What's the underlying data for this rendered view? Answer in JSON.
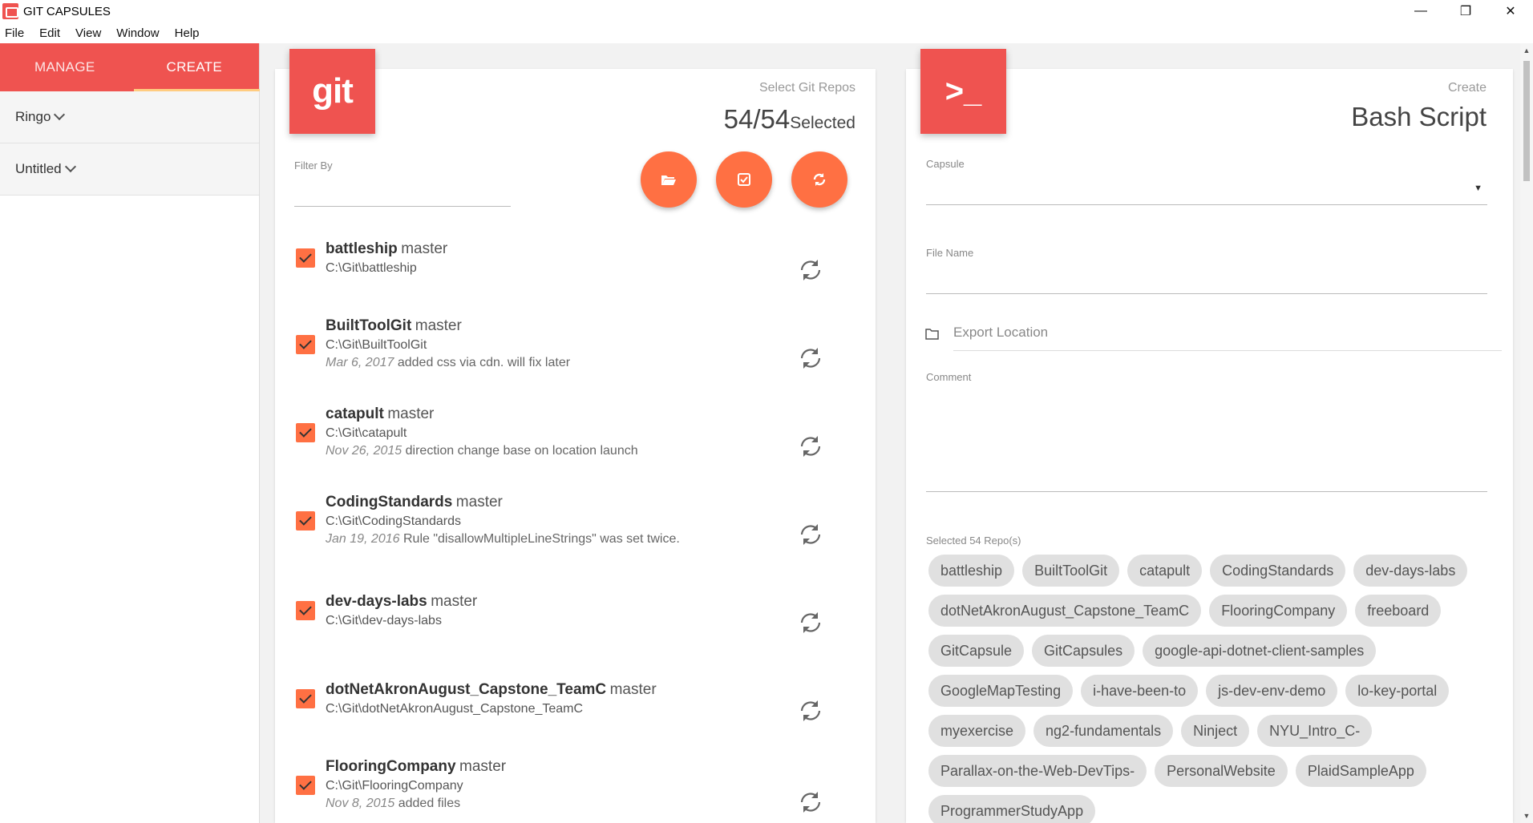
{
  "window": {
    "title": "GIT CAPSULES",
    "controls": [
      "minimize",
      "restore",
      "close"
    ]
  },
  "menu": [
    "File",
    "Edit",
    "View",
    "Window",
    "Help"
  ],
  "sidebar": {
    "tabs": {
      "manage": "MANAGE",
      "create": "CREATE",
      "active": "CREATE"
    },
    "items": [
      {
        "label": "Ringo"
      },
      {
        "label": "Untitled"
      }
    ]
  },
  "repos_panel": {
    "badge": "git",
    "header_small": "Select Git Repos",
    "count": "54/54",
    "count_label": "Selected",
    "filter_label": "Filter By",
    "filter_value": "",
    "actions": [
      {
        "icon": "folder-open-icon"
      },
      {
        "icon": "check-square-icon"
      },
      {
        "icon": "refresh-icon"
      }
    ],
    "repos": [
      {
        "name": "battleship",
        "branch": "master",
        "path": "C:\\Git\\battleship",
        "date": "",
        "message": "",
        "checked": true
      },
      {
        "name": "BuiltToolGit",
        "branch": "master",
        "path": "C:\\Git\\BuiltToolGit",
        "date": "Mar 6, 2017",
        "message": "added css via cdn. will fix later",
        "checked": true
      },
      {
        "name": "catapult",
        "branch": "master",
        "path": "C:\\Git\\catapult",
        "date": "Nov 26, 2015",
        "message": "direction change base on location launch",
        "checked": true
      },
      {
        "name": "CodingStandards",
        "branch": "master",
        "path": "C:\\Git\\CodingStandards",
        "date": "Jan 19, 2016",
        "message": "Rule \"disallowMultipleLineStrings\" was set twice.",
        "checked": true
      },
      {
        "name": "dev-days-labs",
        "branch": "master",
        "path": "C:\\Git\\dev-days-labs",
        "date": "",
        "message": "",
        "checked": true
      },
      {
        "name": "dotNetAkronAugust_Capstone_TeamC",
        "branch": "master",
        "path": "C:\\Git\\dotNetAkronAugust_Capstone_TeamC",
        "date": "",
        "message": "",
        "checked": true
      },
      {
        "name": "FlooringCompany",
        "branch": "master",
        "path": "C:\\Git\\FlooringCompany",
        "date": "Nov 8, 2015",
        "message": "added files",
        "checked": true
      }
    ]
  },
  "script_panel": {
    "badge": ">_",
    "header_small": "Create",
    "header_big": "Bash Script",
    "capsule_label": "Capsule",
    "capsule_value": "",
    "filename_label": "File Name",
    "filename_value": "",
    "export_placeholder": "Export Location",
    "comment_label": "Comment",
    "comment_value": "",
    "selected_label": "Selected 54 Repo(s)",
    "chips": [
      "battleship",
      "BuiltToolGit",
      "catapult",
      "CodingStandards",
      "dev-days-labs",
      "dotNetAkronAugust_Capstone_TeamC",
      "FlooringCompany",
      "freeboard",
      "GitCapsule",
      "GitCapsules",
      "google-api-dotnet-client-samples",
      "GoogleMapTesting",
      "i-have-been-to",
      "js-dev-env-demo",
      "lo-key-portal",
      "myexercise",
      "ng2-fundamentals",
      "Ninject",
      "NYU_Intro_C-",
      "Parallax-on-the-Web-DevTips-",
      "PersonalWebsite",
      "PlaidSampleApp",
      "ProgrammerStudyApp"
    ]
  },
  "colors": {
    "primary": "#ef5350",
    "accent": "#ff7043",
    "tab_indicator": "#ffcc80"
  }
}
